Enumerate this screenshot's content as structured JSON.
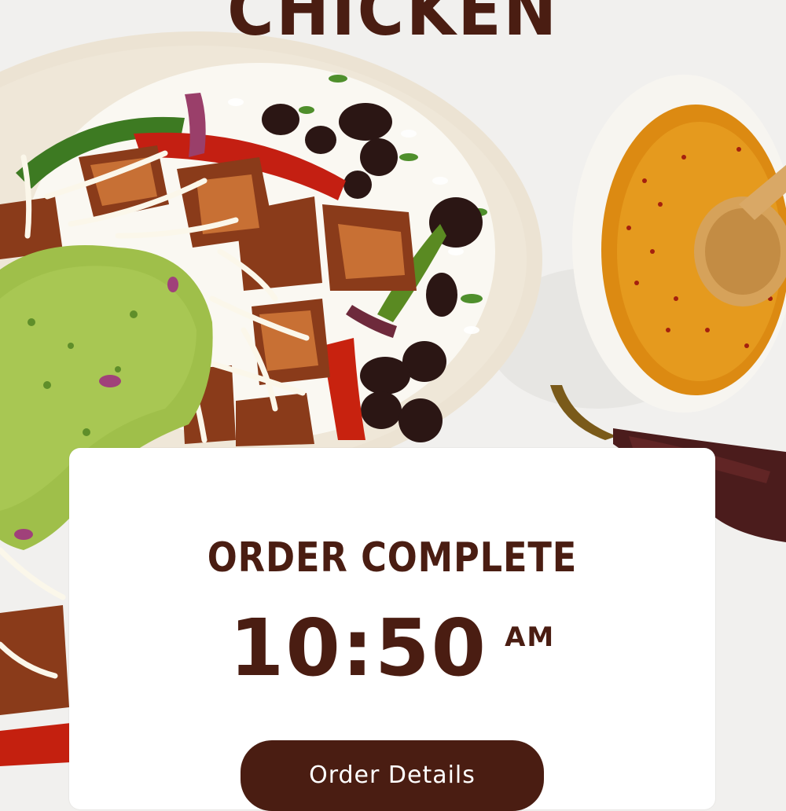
{
  "header": {
    "headline": "CHICKEN"
  },
  "confirmation": {
    "status_label": "ORDER COMPLETE",
    "time": "10:50",
    "meridiem": "AM",
    "details_button_label": "Order Details"
  },
  "icons": [
    "burrito-bowl-image",
    "chili-oil-cup-image",
    "dried-chili-image"
  ],
  "colors": {
    "brand_brown": "#4a1d12",
    "card_background": "#ffffff",
    "page_background": "#f1f0ee",
    "button_text": "#ffffff"
  }
}
